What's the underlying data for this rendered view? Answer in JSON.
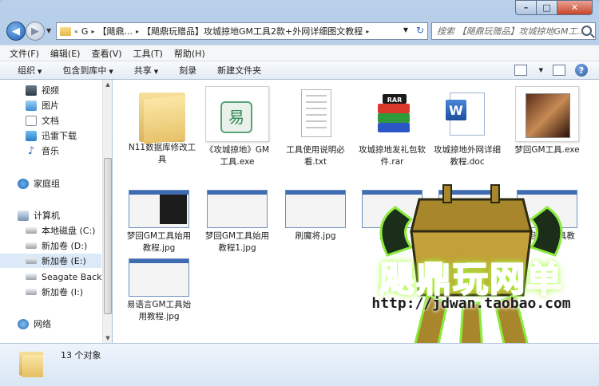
{
  "window": {
    "caption": {
      "minimize": "–",
      "maximize": "□",
      "close": "✕"
    }
  },
  "address": {
    "segments": [
      "G",
      "【飓鼎...",
      "【飓鼎玩赠品】攻城掠地GM工具2款+外网详细图文教程"
    ],
    "search_placeholder": "搜索 【飓鼎玩赠品】攻城掠地GM工..."
  },
  "menu": [
    "文件(F)",
    "编辑(E)",
    "查看(V)",
    "工具(T)",
    "帮助(H)"
  ],
  "toolbar": {
    "organize": "组织",
    "include": "包含到库中",
    "share": "共享",
    "burn": "刻录",
    "new_folder": "新建文件夹"
  },
  "navpane": [
    {
      "label": "视频",
      "icon": "video-icon"
    },
    {
      "label": "图片",
      "icon": "picture-icon"
    },
    {
      "label": "文档",
      "icon": "document-icon"
    },
    {
      "label": "迅雷下载",
      "icon": "download-icon"
    },
    {
      "label": "音乐",
      "icon": "music-icon"
    },
    {
      "label": "家庭组",
      "icon": "homegroup-icon"
    },
    {
      "label": "计算机",
      "icon": "computer-icon"
    },
    {
      "label": "本地磁盘 (C:)",
      "icon": "drive-icon"
    },
    {
      "label": "新加卷 (D:)",
      "icon": "drive-icon"
    },
    {
      "label": "新加卷 (E:)",
      "icon": "drive-icon",
      "selected": true
    },
    {
      "label": "Seagate Backup",
      "icon": "drive-icon"
    },
    {
      "label": "新加卷 (I:)",
      "icon": "drive-icon"
    },
    {
      "label": "网络",
      "icon": "network-icon"
    }
  ],
  "files": [
    {
      "name": "N11数据库修改工具",
      "type": "folder"
    },
    {
      "name": "《攻城掠地》GM工具.exe",
      "type": "exe"
    },
    {
      "name": "工具使用说明必看.txt",
      "type": "txt"
    },
    {
      "name": "攻城掠地发礼包软件.rar",
      "type": "rar"
    },
    {
      "name": "攻城掠地外网详细教程.doc",
      "type": "doc"
    },
    {
      "name": "梦回GM工具.exe",
      "type": "exe-game"
    },
    {
      "name": "梦回GM工具始用教程.jpg",
      "type": "jpg-dark"
    },
    {
      "name": "梦回GM工具始用教程1.jpg",
      "type": "jpg"
    },
    {
      "name": "刷魔将.jpg",
      "type": "jpg"
    },
    {
      "name": "刷魔将",
      "type": "jpg"
    },
    {
      "name": "",
      "type": "jpg"
    },
    {
      "name": "梦回GM工具教",
      "type": "jpg"
    },
    {
      "name": "易语言GM工具始用教程.jpg",
      "type": "jpg"
    }
  ],
  "watermark": {
    "title": "飓鼎玩网单",
    "url": "http://jdwan.taobao.com"
  },
  "details": {
    "count": "13 个对象"
  }
}
